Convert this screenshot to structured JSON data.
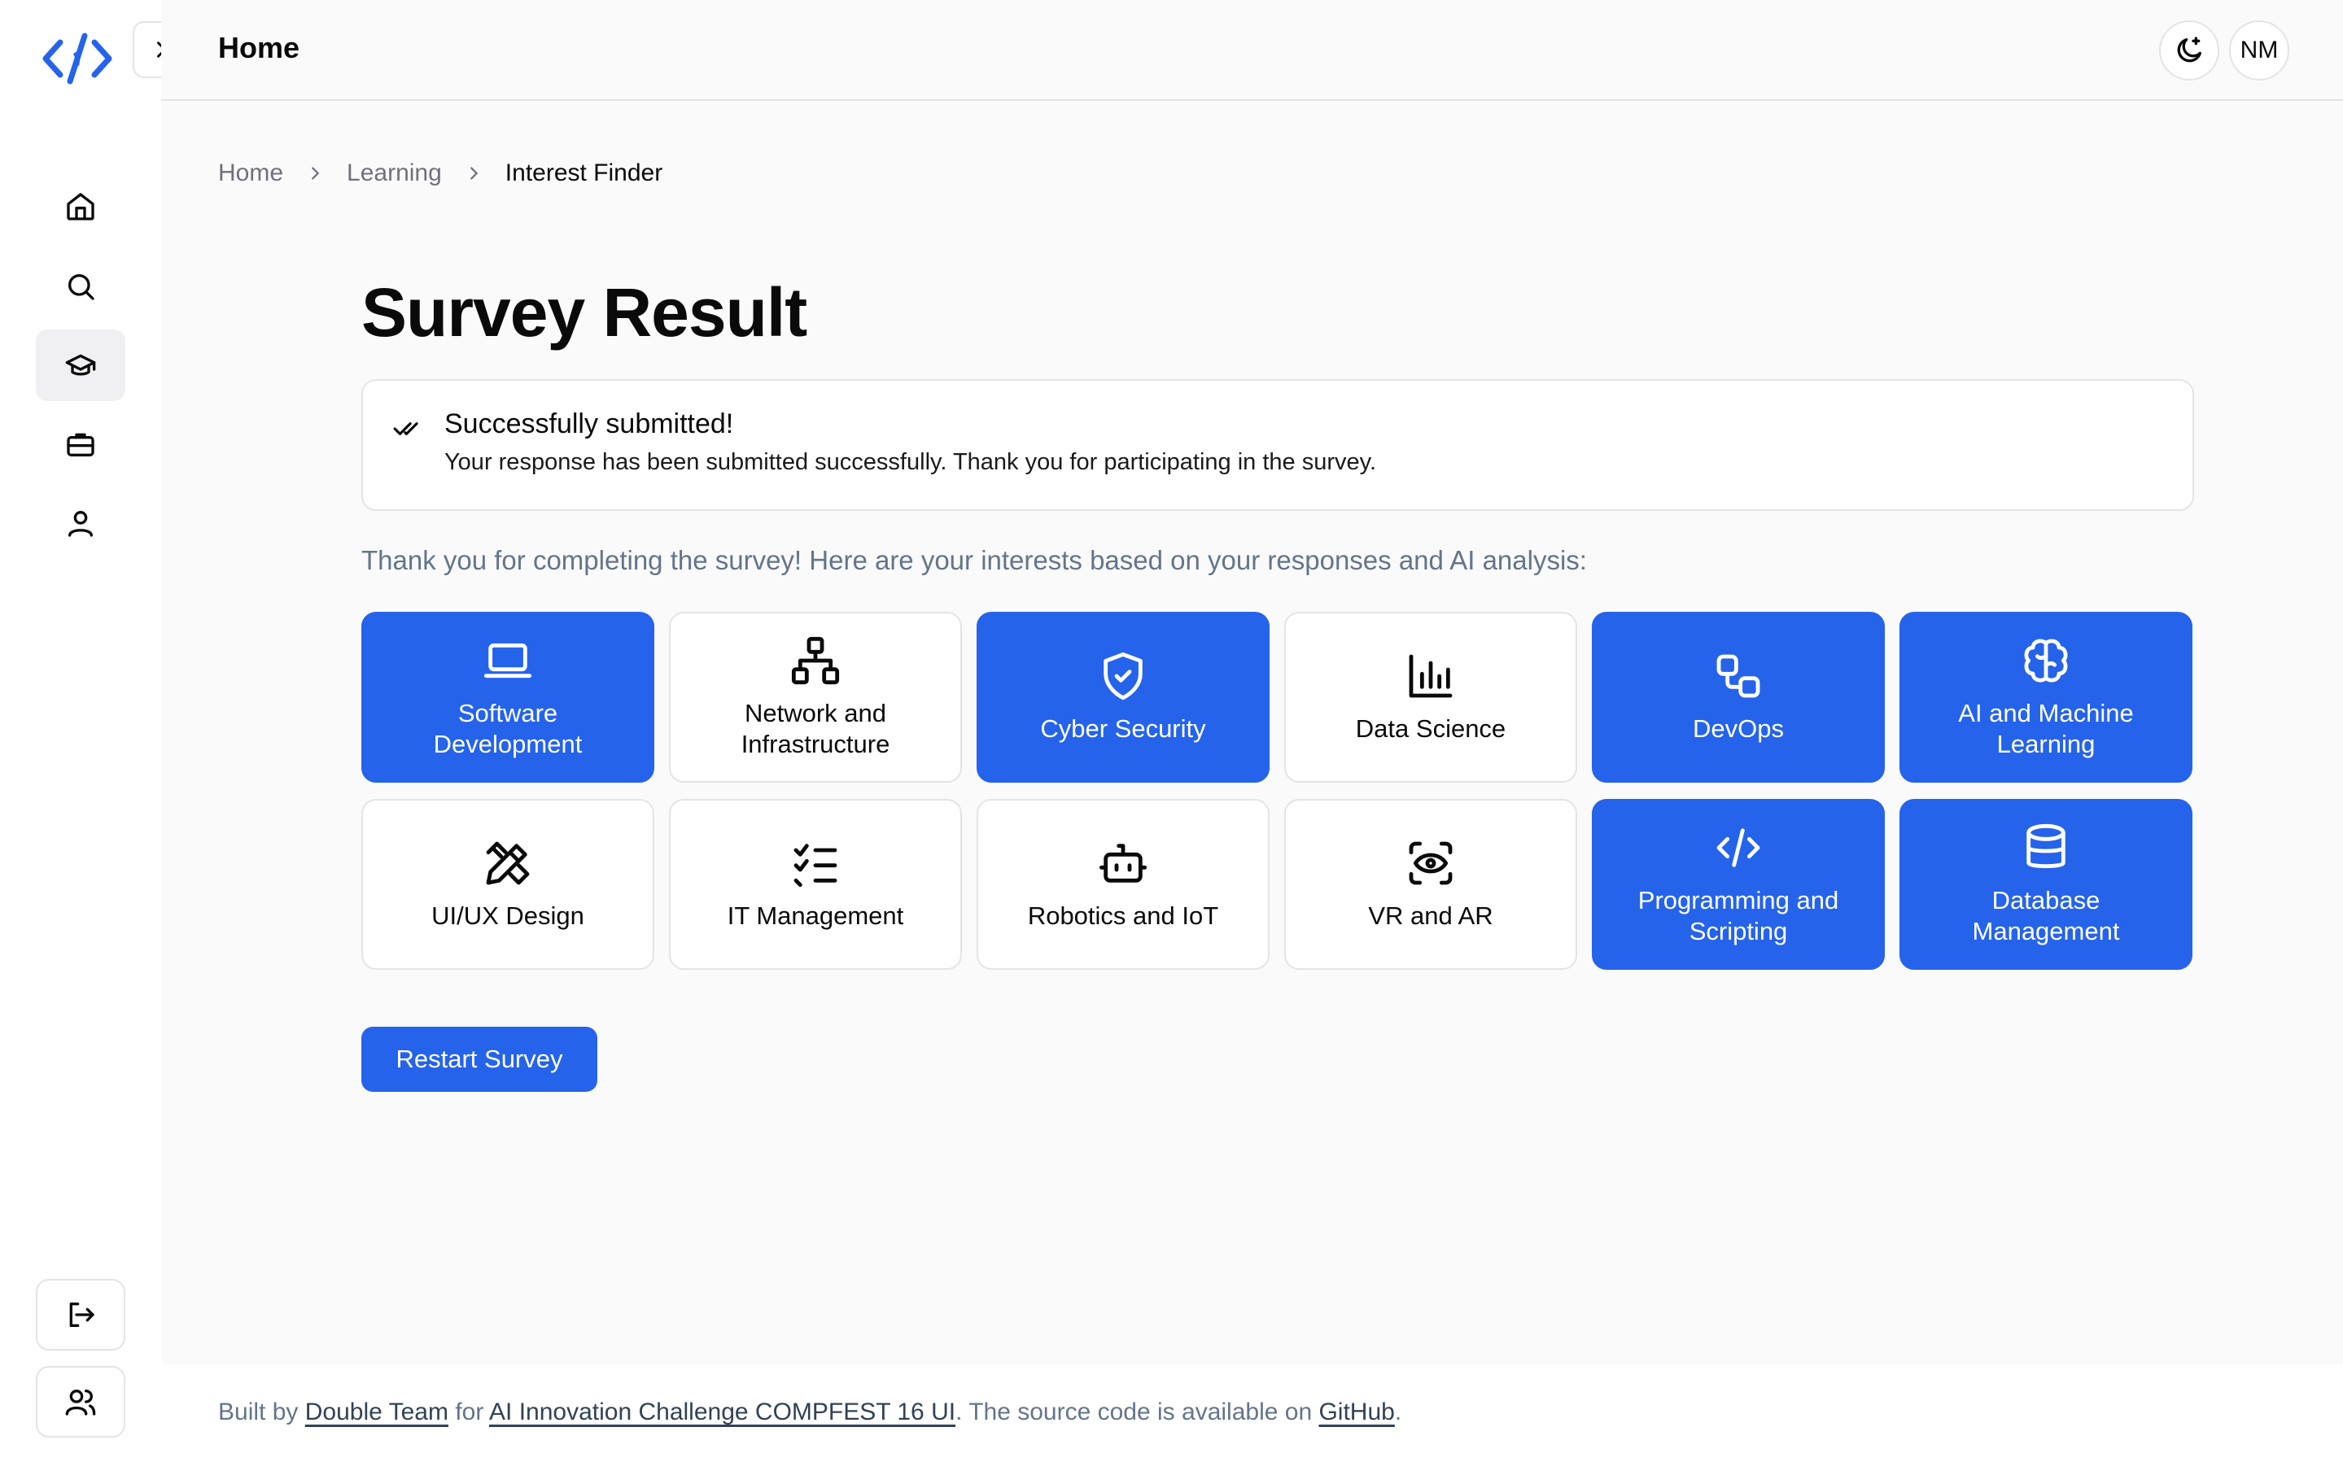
{
  "topbar": {
    "title": "Home",
    "avatar_initials": "NM"
  },
  "breadcrumb": {
    "items": [
      "Home",
      "Learning",
      "Interest Finder"
    ]
  },
  "page": {
    "title": "Survey Result"
  },
  "alert": {
    "title": "Successfully submitted!",
    "description": "Your response has been submitted successfully. Thank you for participating in the survey."
  },
  "intro": "Thank you for completing the survey! Here are your interests based on your responses and AI analysis:",
  "interests": [
    {
      "label": "Software Development",
      "icon": "laptop-icon",
      "selected": true
    },
    {
      "label": "Network and Infrastructure",
      "icon": "network-icon",
      "selected": false
    },
    {
      "label": "Cyber Security",
      "icon": "shield-check-icon",
      "selected": true
    },
    {
      "label": "Data Science",
      "icon": "bar-chart-icon",
      "selected": false
    },
    {
      "label": "DevOps",
      "icon": "workflow-icon",
      "selected": true
    },
    {
      "label": "AI and Machine Learning",
      "icon": "brain-icon",
      "selected": true
    },
    {
      "label": "UI/UX Design",
      "icon": "pencil-ruler-icon",
      "selected": false
    },
    {
      "label": "IT Management",
      "icon": "list-checks-icon",
      "selected": false
    },
    {
      "label": "Robotics and IoT",
      "icon": "bot-icon",
      "selected": false
    },
    {
      "label": "VR and AR",
      "icon": "scan-eye-icon",
      "selected": false
    },
    {
      "label": "Programming and Scripting",
      "icon": "code-icon",
      "selected": true
    },
    {
      "label": "Database Management",
      "icon": "database-icon",
      "selected": true
    }
  ],
  "actions": {
    "restart_label": "Restart Survey"
  },
  "footer": {
    "built_by": "Built by",
    "team": "Double Team",
    "for": "for",
    "challenge": "AI Innovation Challenge COMPFEST 16 UI",
    "source": ". The source code is available on",
    "github": "GitHub",
    "end": "."
  },
  "colors": {
    "accent": "#2563eb",
    "muted_text": "#64748b",
    "border": "#e4e4e7"
  }
}
